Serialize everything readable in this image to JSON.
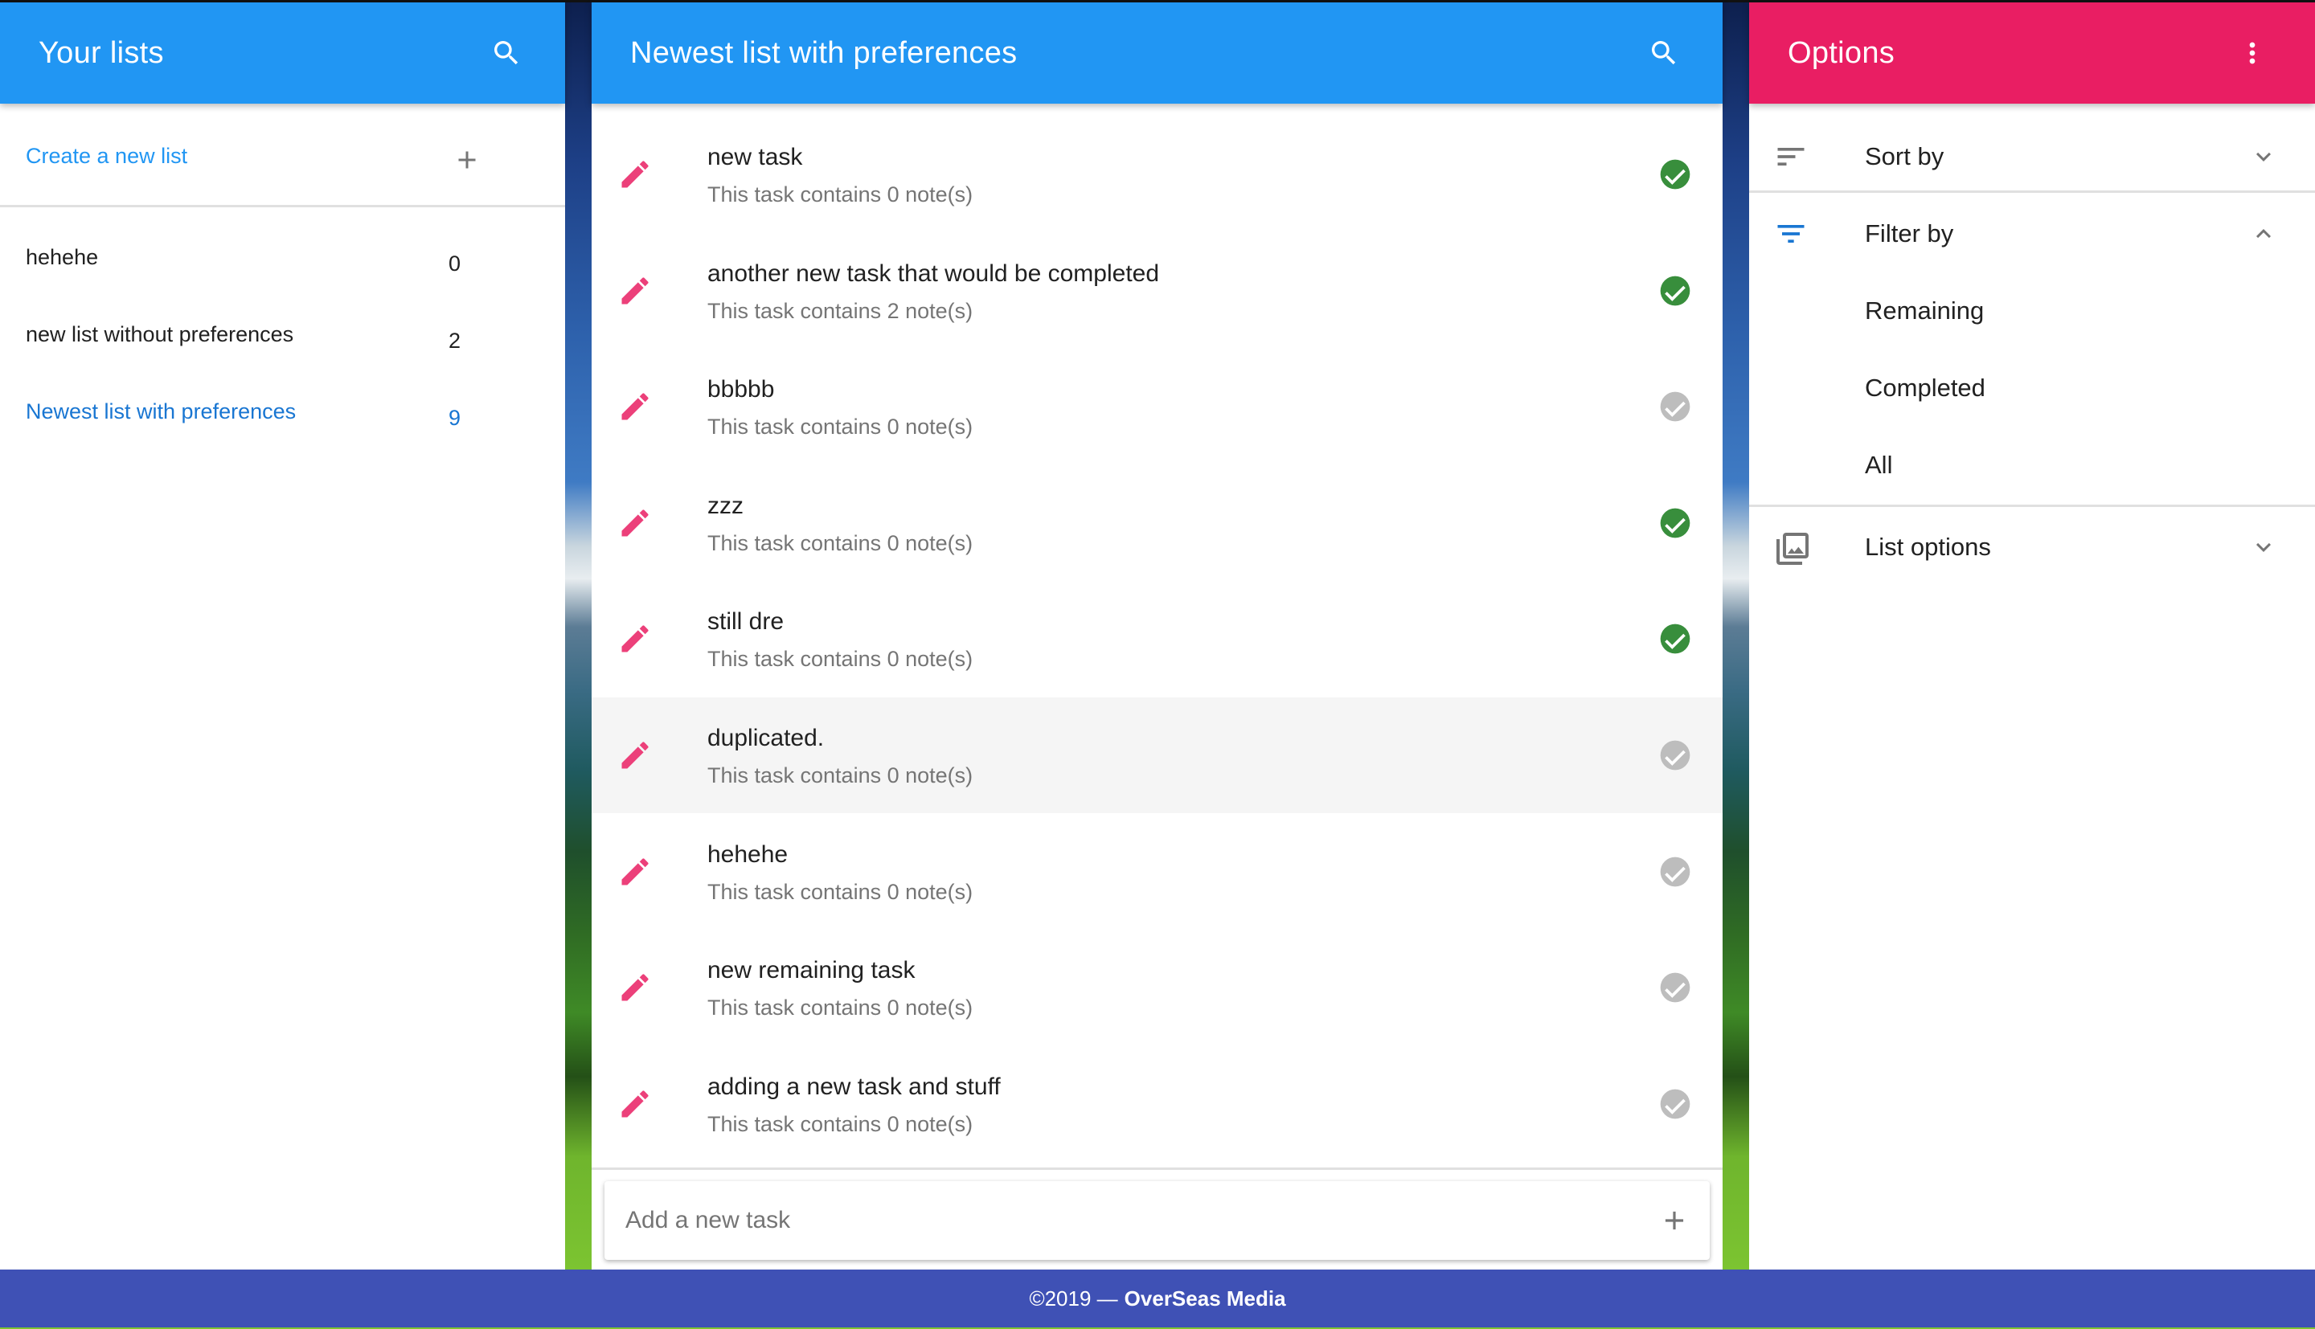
{
  "colors": {
    "primary": "#2196f3",
    "accent": "#e91e63",
    "footer": "#3f51b5",
    "complete": "#388e3c",
    "incomplete": "#bdbdbd",
    "active_link": "#1976d2"
  },
  "lists_panel": {
    "title": "Your lists",
    "search_icon": "search-icon",
    "create_label": "Create a new list",
    "create_icon": "plus-icon",
    "items": [
      {
        "name": "hehehe",
        "count": "0",
        "active": false
      },
      {
        "name": "new list without preferences",
        "count": "2",
        "active": false
      },
      {
        "name": "Newest list with preferences",
        "count": "9",
        "active": true
      }
    ]
  },
  "tasks_panel": {
    "title": "Newest list with preferences",
    "search_icon": "search-icon",
    "tasks": [
      {
        "name": "new task",
        "notes": "This task contains 0 note(s)",
        "completed": true
      },
      {
        "name": "another new task that would be completed",
        "notes": "This task contains 2 note(s)",
        "completed": true
      },
      {
        "name": "bbbbb",
        "notes": "This task contains 0 note(s)",
        "completed": false
      },
      {
        "name": "zzz",
        "notes": "This task contains 0 note(s)",
        "completed": true
      },
      {
        "name": "still dre",
        "notes": "This task contains 0 note(s)",
        "completed": true
      },
      {
        "name": "duplicated.",
        "notes": "This task contains 0 note(s)",
        "completed": false,
        "hovered": true
      },
      {
        "name": "hehehe",
        "notes": "This task contains 0 note(s)",
        "completed": false
      },
      {
        "name": "new remaining task",
        "notes": "This task contains 0 note(s)",
        "completed": false
      },
      {
        "name": "adding a new task and stuff",
        "notes": "This task contains 0 note(s)",
        "completed": false
      }
    ],
    "add_task": {
      "placeholder": "Add a new task",
      "value": ""
    }
  },
  "options_panel": {
    "title": "Options",
    "menu_icon": "more-vert-icon",
    "sort_by": {
      "label": "Sort by",
      "expanded": false
    },
    "filter_by": {
      "label": "Filter by",
      "expanded": true,
      "options": [
        "Remaining",
        "Completed",
        "All"
      ]
    },
    "list_options": {
      "label": "List options",
      "expanded": false
    }
  },
  "footer": {
    "copyright": "©2019 —",
    "brand": "OverSeas Media"
  }
}
